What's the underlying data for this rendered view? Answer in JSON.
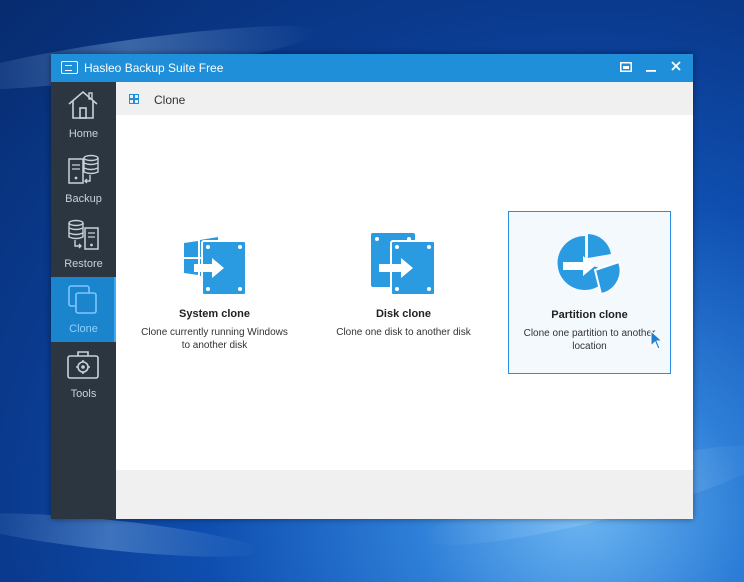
{
  "window": {
    "title": "Hasleo Backup Suite Free",
    "controls": [
      "restore-icon",
      "minimize-icon",
      "close-icon"
    ],
    "titlebar_color": "#1e8fd8"
  },
  "sidebar": {
    "items": [
      {
        "label": "Home",
        "icon": "home-icon"
      },
      {
        "label": "Backup",
        "icon": "backup-icon"
      },
      {
        "label": "Restore",
        "icon": "restore-icon"
      },
      {
        "label": "Clone",
        "icon": "clone-icon",
        "active": true
      },
      {
        "label": "Tools",
        "icon": "tools-icon"
      }
    ]
  },
  "header": {
    "title": "Clone"
  },
  "cards": [
    {
      "title": "System clone",
      "desc": "Clone currently running Windows to another disk",
      "icon": "system-clone-icon"
    },
    {
      "title": "Disk clone",
      "desc": "Clone one disk to another disk",
      "icon": "disk-clone-icon"
    },
    {
      "title": "Partition clone",
      "desc": "Clone one partition to another location",
      "icon": "partition-clone-icon",
      "selected": true
    }
  ],
  "colors": {
    "accent": "#2a9be0",
    "sidebar": "#2b3640",
    "active_nav": "#1a84cc"
  }
}
